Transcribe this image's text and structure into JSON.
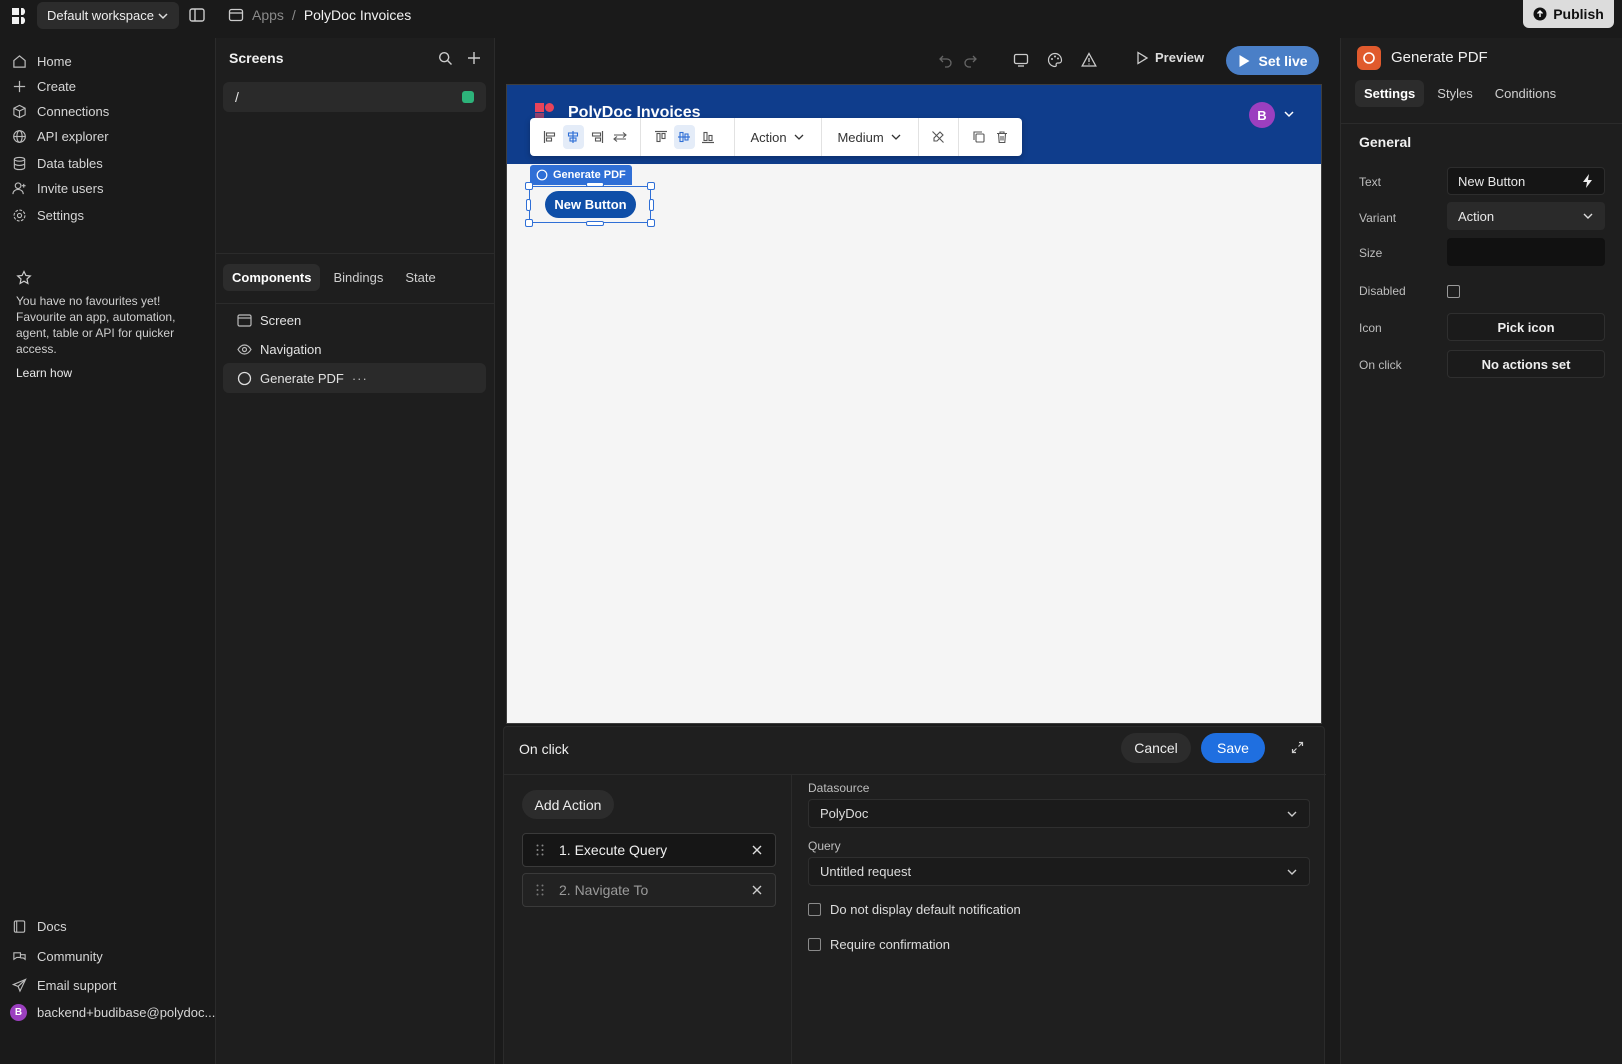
{
  "topbar": {
    "workspace": "Default workspace",
    "breadcrumb_root": "Apps",
    "breadcrumb_sep": "/",
    "breadcrumb_current": "PolyDoc Invoices",
    "publish_label": "Publish"
  },
  "leftnav": {
    "items": [
      {
        "label": "Home",
        "icon": "home-icon"
      },
      {
        "label": "Create",
        "icon": "plus-icon"
      },
      {
        "label": "Connections",
        "icon": "box-icon"
      },
      {
        "label": "API explorer",
        "icon": "globe-icon"
      },
      {
        "label": "Data tables",
        "icon": "database-icon"
      },
      {
        "label": "Invite users",
        "icon": "user-plus-icon"
      },
      {
        "label": "Settings",
        "icon": "gear-icon"
      }
    ],
    "favourites_text": "You have no favourites yet! Favourite an app, automation, agent, table or API for quicker access.",
    "learn_how": "Learn how",
    "footer": [
      {
        "label": "Docs",
        "icon": "book-icon"
      },
      {
        "label": "Community",
        "icon": "community-icon"
      },
      {
        "label": "Email support",
        "icon": "send-icon"
      }
    ],
    "user_email": "backend+budibase@polydoc....",
    "user_initial": "B"
  },
  "screens": {
    "title": "Screens",
    "route": "/",
    "tabs": [
      "Components",
      "Bindings",
      "State"
    ],
    "tree": [
      {
        "label": "Screen",
        "icon": "screen-icon"
      },
      {
        "label": "Navigation",
        "icon": "eye-icon"
      },
      {
        "label": "Generate PDF",
        "icon": "circle-icon",
        "more": "···"
      }
    ]
  },
  "canvas": {
    "preview_label": "Preview",
    "setlive_label": "Set live",
    "app_title": "PolyDoc Invoices",
    "app_avatar": "B",
    "toolbar_variant": "Action",
    "toolbar_size": "Medium",
    "selection_label": "Generate PDF",
    "button_text": "New Button"
  },
  "onclick": {
    "title": "On click",
    "cancel": "Cancel",
    "save": "Save",
    "add_action": "Add Action",
    "actions": [
      "1. Execute Query",
      "2. Navigate To"
    ],
    "datasource_label": "Datasource",
    "datasource_value": "PolyDoc",
    "query_label": "Query",
    "query_value": "Untitled request",
    "checkbox_1": "Do not display default notification",
    "checkbox_2": "Require confirmation"
  },
  "settings": {
    "component_name": "Generate PDF",
    "tabs": [
      "Settings",
      "Styles",
      "Conditions"
    ],
    "section": "General",
    "text_label": "Text",
    "text_value": "New Button",
    "variant_label": "Variant",
    "variant_value": "Action",
    "size_label": "Size",
    "disabled_label": "Disabled",
    "icon_label": "Icon",
    "icon_button": "Pick icon",
    "onclick_label": "On click",
    "onclick_button": "No actions set"
  },
  "colors": {
    "accent": "#1f6fe0",
    "app_header": "#0f3d8c",
    "brand_orange": "#e05a2d",
    "status_green": "#2db37a"
  }
}
